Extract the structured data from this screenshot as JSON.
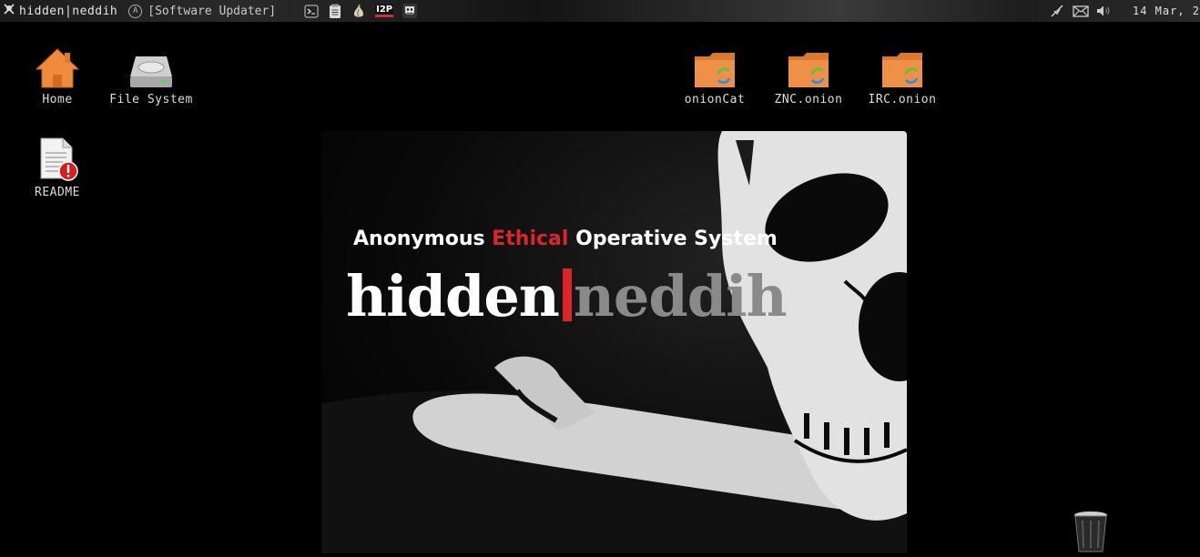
{
  "panel": {
    "app_name": "hidden|neddih",
    "task_label": "[Software Updater]",
    "task_badge": "A",
    "launchers": [
      "terminal-icon",
      "text-editor-icon",
      "tor-onion-icon",
      "i2p-icon",
      "anonymous-mask-icon"
    ],
    "i2p_label": "I2P",
    "tray": [
      "network-icon",
      "mail-icon",
      "volume-icon"
    ],
    "clock": "14 Mar, 2"
  },
  "desktop": {
    "home": "Home",
    "filesystem": "File System",
    "readme": "README",
    "onioncat": "onionCat",
    "znc": "ZNC.onion",
    "irc": "IRC.onion"
  },
  "wallpaper": {
    "tag_1": "Anonymous ",
    "tag_2": "Ethical",
    "tag_3": " Operative System",
    "logo_left": "hidden",
    "logo_right": "neddih"
  },
  "colors": {
    "accent_red": "#d9262b",
    "folder_orange": "#e8873a",
    "home_orange": "#f08a3c"
  }
}
